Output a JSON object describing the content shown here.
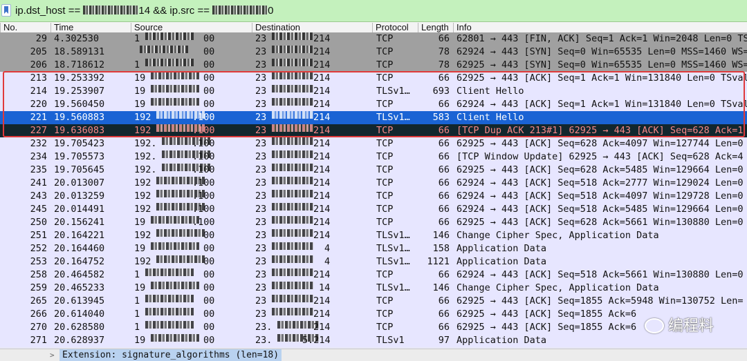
{
  "filter": {
    "part1": "ip.dst_host == ",
    "part2": "14 && ip.src == ",
    "part3": "0"
  },
  "columns": {
    "no": "No.",
    "time": "Time",
    "source": "Source",
    "destination": "Destination",
    "protocol": "Protocol",
    "length": "Length",
    "info": "Info"
  },
  "packets": [
    {
      "no": "29",
      "time": "4.302530",
      "src": "1",
      "dst": "23",
      "proto": "TCP",
      "len": "66",
      "info": "62801 → 443 [FIN, ACK] Seq=1 Ack=1 Win=2048 Len=0 TSva",
      "style": "dark",
      "src_end": "00",
      "dst_end": "214"
    },
    {
      "no": "205",
      "time": "18.589131",
      "src": "",
      "dst": "23",
      "proto": "TCP",
      "len": "78",
      "info": "62924 → 443 [SYN] Seq=0 Win=65535 Len=0 MSS=1460 WS=",
      "style": "dark",
      "src_end": "00",
      "dst_end": "214"
    },
    {
      "no": "206",
      "time": "18.718612",
      "src": "1",
      "dst": "23",
      "proto": "TCP",
      "len": "78",
      "info": "62925 → 443 [SYN] Seq=0 Win=65535 Len=0 MSS=1460 WS=",
      "style": "dark",
      "src_end": "00",
      "dst_end": "214"
    },
    {
      "no": "213",
      "time": "19.253392",
      "src": "19",
      "dst": "23",
      "proto": "TCP",
      "len": "66",
      "info": "62925 → 443 [ACK] Seq=1 Ack=1 Win=131840 Len=0 TSval",
      "style": "tcp",
      "src_end": "00",
      "dst_end": "214"
    },
    {
      "no": "214",
      "time": "19.253907",
      "src": "19",
      "dst": "23",
      "proto": "TLSv1…",
      "len": "693",
      "info": "Client Hello",
      "style": "tls",
      "src_end": "00",
      "dst_end": "214"
    },
    {
      "no": "220",
      "time": "19.560450",
      "src": "19",
      "dst": "23",
      "proto": "TCP",
      "len": "66",
      "info": "62924 → 443 [ACK] Seq=1 Ack=1 Win=131840 Len=0 TSval",
      "style": "tcp",
      "src_end": "00",
      "dst_end": "214"
    },
    {
      "no": "221",
      "time": "19.560883",
      "src": "192",
      "dst": "23",
      "proto": "TLSv1…",
      "len": "583",
      "info": "Client Hello",
      "style": "selected",
      "src_end": ".100",
      "dst_end": "214"
    },
    {
      "no": "227",
      "time": "19.636083",
      "src": "192",
      "dst": "23",
      "proto": "TCP",
      "len": "66",
      "info": "[TCP Dup ACK 213#1] 62925 → 443 [ACK] Seq=628 Ack=1",
      "style": "bad",
      "src_end": ".100",
      "dst_end": "214"
    },
    {
      "no": "232",
      "time": "19.705423",
      "src": "192.",
      "dst": "23",
      "proto": "TCP",
      "len": "66",
      "info": "62925 → 443 [ACK] Seq=628 Ack=4097 Win=127744 Len=0",
      "style": "tcp",
      "src_end": ".100",
      "dst_end": "214"
    },
    {
      "no": "234",
      "time": "19.705573",
      "src": "192.",
      "dst": "23",
      "proto": "TCP",
      "len": "66",
      "info": "[TCP Window Update] 62925 → 443 [ACK] Seq=628 Ack=4",
      "style": "tcp",
      "src_end": ".100",
      "dst_end": "214"
    },
    {
      "no": "235",
      "time": "19.705645",
      "src": "192.",
      "dst": "23",
      "proto": "TCP",
      "len": "66",
      "info": "62925 → 443 [ACK] Seq=628 Ack=5485 Win=129664 Len=0",
      "style": "tcp",
      "src_end": ".100",
      "dst_end": "214"
    },
    {
      "no": "241",
      "time": "20.013007",
      "src": "192",
      "dst": "23",
      "proto": "TCP",
      "len": "66",
      "info": "62924 → 443 [ACK] Seq=518 Ack=2777 Win=129024 Len=0",
      "style": "tcp",
      "src_end": ".100",
      "dst_end": "214"
    },
    {
      "no": "243",
      "time": "20.013259",
      "src": "192",
      "dst": "23",
      "proto": "TCP",
      "len": "66",
      "info": "62924 → 443 [ACK] Seq=518 Ack=4097 Win=129728 Len=0",
      "style": "tcp",
      "src_end": ".100",
      "dst_end": "214"
    },
    {
      "no": "245",
      "time": "20.014491",
      "src": "192",
      "dst": "23",
      "proto": "TCP",
      "len": "66",
      "info": "62924 → 443 [ACK] Seq=518 Ack=5485 Win=129664 Len=0",
      "style": "tcp",
      "src_end": ".100",
      "dst_end": "214"
    },
    {
      "no": "250",
      "time": "20.156241",
      "src": "19",
      "dst": "23",
      "proto": "TCP",
      "len": "66",
      "info": "62925 → 443 [ACK] Seq=628 Ack=5661 Win=130880 Len=0",
      "style": "tcp",
      "src_end": ".100",
      "dst_end": "214"
    },
    {
      "no": "251",
      "time": "20.164221",
      "src": "192",
      "dst": "23",
      "proto": "TLSv1…",
      "len": "146",
      "info": "Change Cipher Spec, Application Data",
      "style": "tls",
      "src_end": "00",
      "dst_end": "214"
    },
    {
      "no": "252",
      "time": "20.164460",
      "src": "19",
      "dst": "23",
      "proto": "TLSv1…",
      "len": "158",
      "info": "Application Data",
      "style": "tls",
      "src_end": "00",
      "dst_end": "4"
    },
    {
      "no": "253",
      "time": "20.164752",
      "src": "192",
      "dst": "23",
      "proto": "TLSv1…",
      "len": "1121",
      "info": "Application Data",
      "style": "tls",
      "src_end": "00",
      "dst_end": "4"
    },
    {
      "no": "258",
      "time": "20.464582",
      "src": "1",
      "dst": "23",
      "proto": "TCP",
      "len": "66",
      "info": "62924 → 443 [ACK] Seq=518 Ack=5661 Win=130880 Len=0",
      "style": "tcp",
      "src_end": "00",
      "dst_end": "214"
    },
    {
      "no": "259",
      "time": "20.465233",
      "src": "19",
      "dst": "23",
      "proto": "TLSv1…",
      "len": "146",
      "info": "Change Cipher Spec, Application Data",
      "style": "tls",
      "src_end": "00",
      "dst_end": "14"
    },
    {
      "no": "265",
      "time": "20.613945",
      "src": "1",
      "dst": "23",
      "proto": "TCP",
      "len": "66",
      "info": "62925 → 443 [ACK] Seq=1855 Ack=5948 Win=130752 Len=",
      "style": "tcp",
      "src_end": "00",
      "dst_end": "214"
    },
    {
      "no": "266",
      "time": "20.614040",
      "src": "1",
      "dst": "23",
      "proto": "TCP",
      "len": "66",
      "info": "62925 → 443 [ACK] Seq=1855 Ack=6",
      "style": "tcp",
      "src_end": "00",
      "dst_end": "214"
    },
    {
      "no": "270",
      "time": "20.628580",
      "src": "1",
      "dst": "23.",
      "proto": "TCP",
      "len": "66",
      "info": "62925 → 443 [ACK] Seq=1855 Ack=6",
      "style": "tcp",
      "src_end": "00",
      "dst_end": "214"
    },
    {
      "no": "271",
      "time": "20.628937",
      "src": "19",
      "dst": "23.",
      "proto": "TLSv1",
      "len": "97",
      "info": "Application Data",
      "style": "tls",
      "src_end": "00",
      "dst_end": "5.214"
    }
  ],
  "detail": {
    "caret": ">",
    "text": "Extension: signature_algorithms (len=18)"
  },
  "watermark": {
    "text": "编程料"
  },
  "colors": {
    "filter_bg": "#c4f1bd",
    "selected_bg": "#1a63d4",
    "bad_bg": "#12272e",
    "bad_fg": "#f78787",
    "row_bg": "#e7e6ff",
    "highlight": "#e03a3a"
  },
  "icons": {
    "bookmark": "bookmark-icon",
    "expand": "chevron-right-icon"
  }
}
